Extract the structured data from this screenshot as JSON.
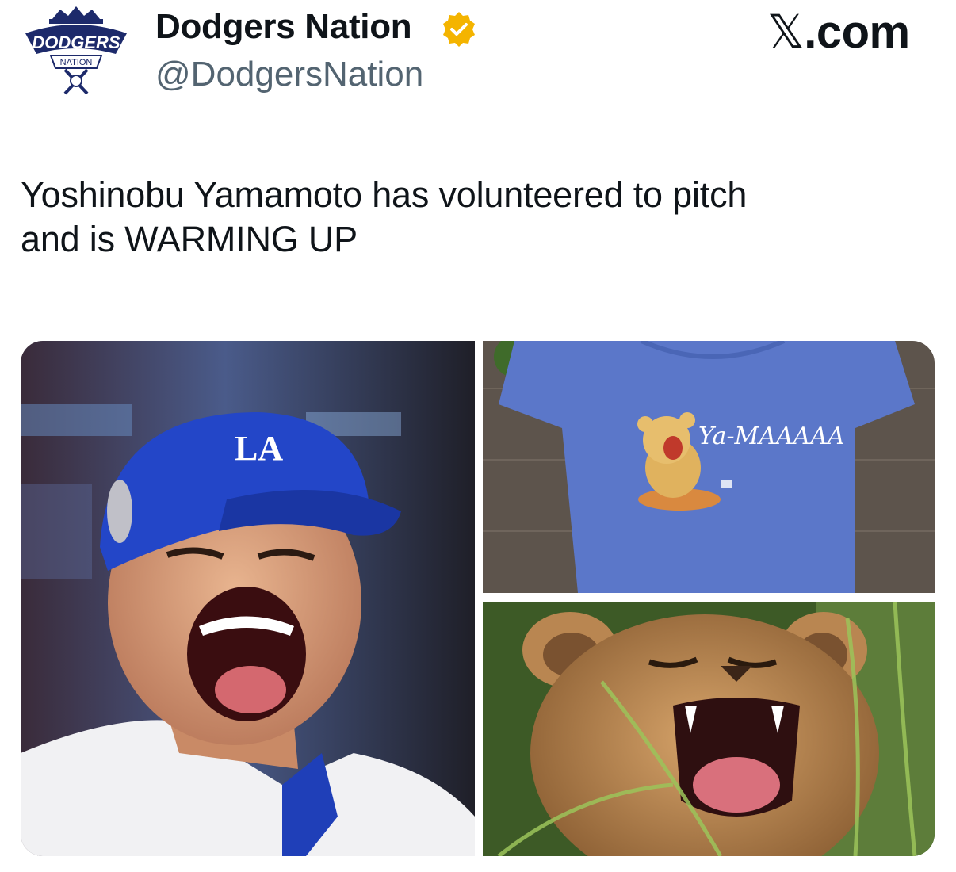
{
  "author": {
    "name": "Dodgers Nation",
    "handle": "@DodgersNation",
    "verified": true,
    "avatar_icon": "dodgers-nation-logo-icon",
    "avatar_wordmark": "DODGERS",
    "avatar_sub": "NATION"
  },
  "brand": {
    "x_glyph": "𝕏",
    "suffix": ".com"
  },
  "tweet": {
    "line1": "Yoshinobu Yamamoto has volunteered to pitch",
    "line2": "and is WARMING UP"
  },
  "media": {
    "shirt_text": "Ya-MAAAAA",
    "hat_logo": "LA"
  },
  "colors": {
    "verified": "#f4b400",
    "dodger_blue": "#1f3fb8",
    "shirt_blue": "#5b77c9",
    "handle_gray": "#536471"
  }
}
